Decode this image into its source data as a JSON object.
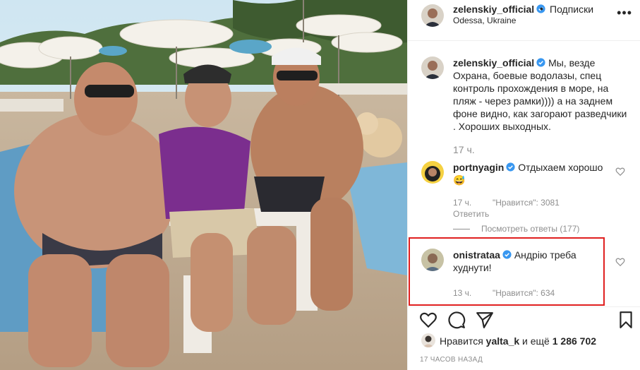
{
  "post": {
    "username": "zelenskiy_official",
    "follow_label": "Подписки",
    "dot": "•",
    "location": "Odessa, Ukraine",
    "more_label": "•••"
  },
  "caption": {
    "username": "zelenskiy_official",
    "text": "Мы, везде Охрана, боевые водолазы, спец контроль прохождения в море, на пляж - через рамки)))) а на заднем фоне видно, как загорают разведчики . Хороших выходных.",
    "time": "17 ч."
  },
  "comments": [
    {
      "username": "portnyagin",
      "text": "Отдыхаем хорошо 😅",
      "time": "17 ч.",
      "likes_label": "\"Нравится\": 3081",
      "reply_label": "Ответить",
      "view_replies": "Посмотреть ответы (177)"
    },
    {
      "username": "onistrataa",
      "text": "Андрію треба худнути!",
      "time": "13 ч.",
      "likes_label": "\"Нравится\": 634"
    }
  ],
  "likes": {
    "prefix": "Нравится",
    "user": "yalta_k",
    "suffix": "и ещё",
    "count": "1 286 702"
  },
  "timestamp": "17 ЧАСОВ НАЗАД",
  "colors": {
    "verified": "#3897f0",
    "highlight_border": "#e02020",
    "meta_text": "#8e8e8e"
  },
  "icons": [
    "verified-icon",
    "heart-icon",
    "comment-icon",
    "share-icon",
    "bookmark-icon",
    "more-icon"
  ]
}
